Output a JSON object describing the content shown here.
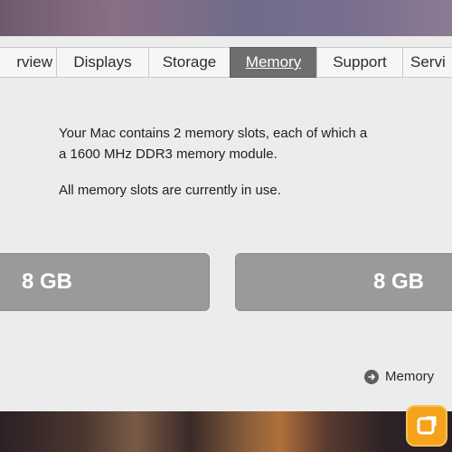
{
  "tabs": [
    {
      "label": "rview",
      "active": false
    },
    {
      "label": "Displays",
      "active": false
    },
    {
      "label": "Storage",
      "active": false
    },
    {
      "label": "Memory",
      "active": true
    },
    {
      "label": "Support",
      "active": false
    },
    {
      "label": "Servi",
      "active": false
    }
  ],
  "memory": {
    "description_line1": "Your Mac contains 2 memory slots, each of which a",
    "description_line2": "a 1600 MHz DDR3 memory module.",
    "status": "All memory slots are currently in use.",
    "slots": [
      {
        "label": "8 GB"
      },
      {
        "label": "8 GB"
      }
    ],
    "link_label": "Memory"
  },
  "colors": {
    "active_tab": "#6e6e6e",
    "slot_fill": "#9a9a9a",
    "window_bg": "#ececec",
    "badge": "#f6a21a"
  },
  "icons": {
    "memory_link": "circle-arrow-icon",
    "badge": "app-badge-icon"
  }
}
